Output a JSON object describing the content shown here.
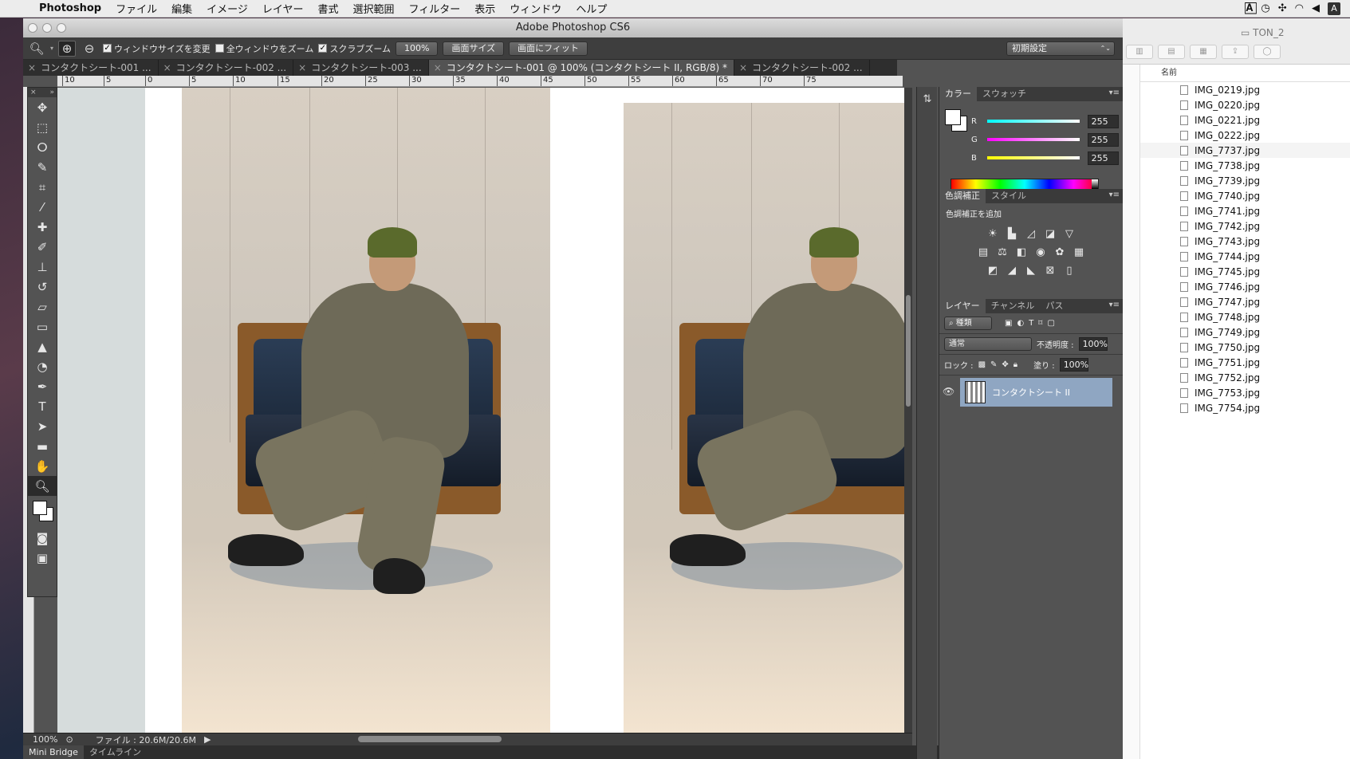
{
  "menubar": {
    "app": "Photoshop",
    "items": [
      "ファイル",
      "編集",
      "イメージ",
      "レイヤー",
      "書式",
      "選択範囲",
      "フィルター",
      "表示",
      "ウィンドウ",
      "ヘルプ"
    ],
    "right_user": "A"
  },
  "window": {
    "title": "Adobe Photoshop CS6"
  },
  "options": {
    "check_resize": "ウィンドウサイズを変更",
    "check_allwin": "全ウィンドウをズーム",
    "check_scrubby": "スクラブズーム",
    "btn_100": "100%",
    "btn_screen": "画面サイズ",
    "btn_fit": "画面にフィット",
    "workspace": "初期設定"
  },
  "tabs": [
    {
      "label": "コンタクトシート-001 ..."
    },
    {
      "label": "コンタクトシート-002 ..."
    },
    {
      "label": "コンタクトシート-003 ..."
    },
    {
      "label": "コンタクトシート-001 @ 100% (コンタクトシート II, RGB/8) *"
    },
    {
      "label": "コンタクトシート-002 ..."
    }
  ],
  "ruler_h": [
    "10",
    "5",
    "0",
    "5",
    "10",
    "15",
    "20",
    "25",
    "30",
    "35",
    "40",
    "45",
    "50",
    "55",
    "60",
    "65",
    "70",
    "75"
  ],
  "status": {
    "zoom": "100%",
    "file": "ファイル : 20.6M/20.6M"
  },
  "bottom_tabs": [
    "Mini Bridge",
    "タイムライン"
  ],
  "color_panel": {
    "tabs": [
      "カラー",
      "スウォッチ"
    ],
    "r_label": "R",
    "g_label": "G",
    "b_label": "B",
    "r": "255",
    "g": "255",
    "b": "255"
  },
  "adjust_panel": {
    "tabs": [
      "色調補正",
      "スタイル"
    ],
    "caption": "色調補正を追加"
  },
  "layers_panel": {
    "tabs": [
      "レイヤー",
      "チャンネル",
      "パス"
    ],
    "filter": "種類",
    "blend": "通常",
    "opacity_label": "不透明度 :",
    "opacity": "100%",
    "lock_label": "ロック :",
    "fill_label": "塗り :",
    "fill": "100%",
    "layer_name": "コンタクトシート II"
  },
  "finder": {
    "folder": "TON_2",
    "col_name": "名前",
    "files": [
      "IMG_0219.jpg",
      "IMG_0220.jpg",
      "IMG_0221.jpg",
      "IMG_0222.jpg",
      "IMG_7737.jpg",
      "IMG_7738.jpg",
      "IMG_7739.jpg",
      "IMG_7740.jpg",
      "IMG_7741.jpg",
      "IMG_7742.jpg",
      "IMG_7743.jpg",
      "IMG_7744.jpg",
      "IMG_7745.jpg",
      "IMG_7746.jpg",
      "IMG_7747.jpg",
      "IMG_7748.jpg",
      "IMG_7749.jpg",
      "IMG_7750.jpg",
      "IMG_7751.jpg",
      "IMG_7752.jpg",
      "IMG_7753.jpg",
      "IMG_7754.jpg"
    ]
  }
}
